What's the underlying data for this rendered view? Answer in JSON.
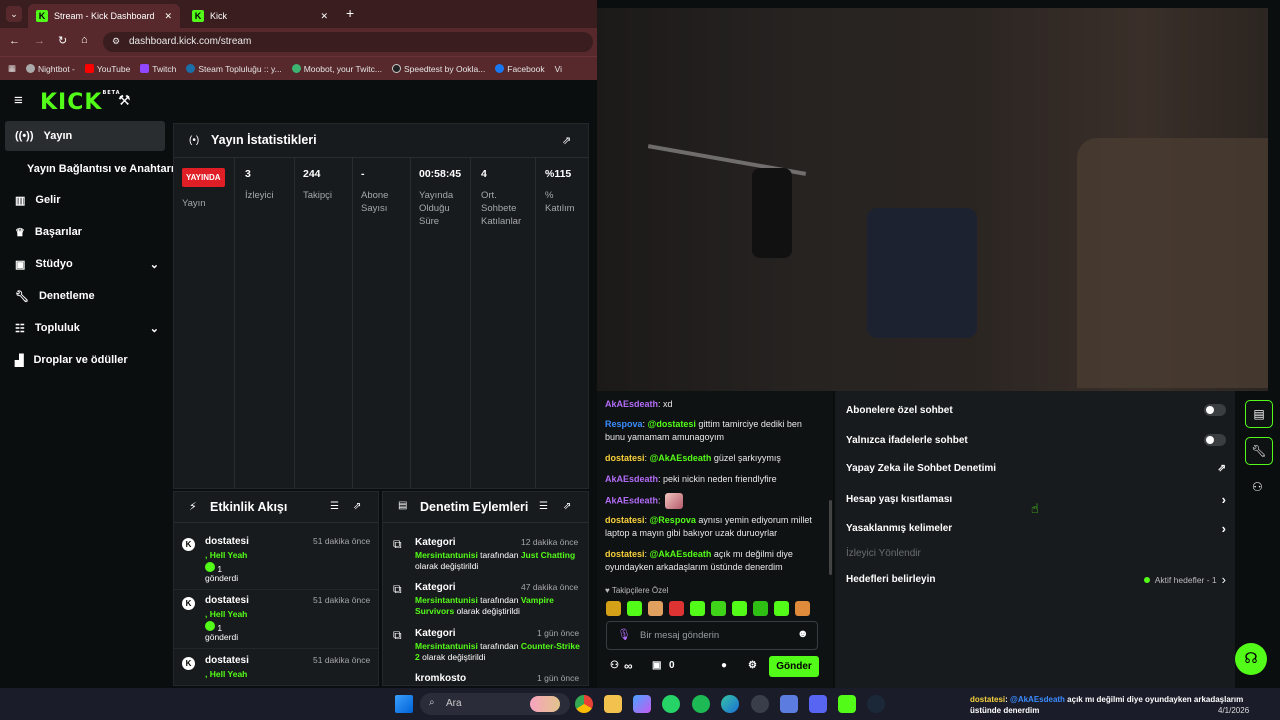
{
  "browser": {
    "tabs": [
      {
        "label": "Stream - Kick Dashboard",
        "active": true
      },
      {
        "label": "Kick",
        "active": false
      }
    ],
    "url": "dashboard.kick.com/stream",
    "bookmarks": [
      "Nightbot -",
      "YouTube",
      "Twitch",
      "Steam Topluluğu :: y...",
      "Moobot, your Twitc...",
      "Speedtest by Ookla...",
      "Facebook",
      "Vi"
    ]
  },
  "brand": {
    "logo": "KICK",
    "beta": "BETA",
    "accent": "#53fc18"
  },
  "sidebar": {
    "items": [
      {
        "label": "Yayın",
        "icon": "broadcast-icon"
      },
      {
        "label": "Yayın Bağlantısı ve Anahtarı",
        "icon": ""
      },
      {
        "label": "Gelir",
        "icon": "chart-icon"
      },
      {
        "label": "Başarılar",
        "icon": "trophy-icon"
      },
      {
        "label": "Stüdyo",
        "icon": "studio-icon"
      },
      {
        "label": "Denetleme",
        "icon": "wrench-icon"
      },
      {
        "label": "Topluluk",
        "icon": "community-icon"
      },
      {
        "label": "Droplar ve ödüller",
        "icon": "drops-icon"
      }
    ]
  },
  "stats": {
    "title": "Yayın İstatistikleri",
    "live_badge": "YAYINDA",
    "live_label": "Yayın",
    "cols": [
      {
        "value": "3",
        "label": "İzleyici"
      },
      {
        "value": "244",
        "label": "Takipçi"
      },
      {
        "value": "-",
        "label": "Abone Sayısı"
      },
      {
        "value": "00:58:45",
        "label": "Yayında Olduğu Süre"
      },
      {
        "value": "4",
        "label": "Ort. Sohbete Katılanlar"
      },
      {
        "value": "%115",
        "label": "% Katılım"
      }
    ]
  },
  "activity": {
    "title": "Etkinlik Akışı",
    "items": [
      {
        "user": "dostatesi",
        "time": "51 dakika önce",
        "text1": ", Hell Yeah",
        "count": "1",
        "text2": "gönderdi"
      },
      {
        "user": "dostatesi",
        "time": "51 dakika önce",
        "text1": ", Hell Yeah",
        "count": "1",
        "text2": "gönderdi"
      },
      {
        "user": "dostatesi",
        "time": "51 dakika önce",
        "text1": ", Hell Yeah",
        "count": "",
        "text2": ""
      }
    ]
  },
  "moderation": {
    "title": "Denetim Eylemleri",
    "items": [
      {
        "title": "Kategori",
        "time": "12 dakika önce",
        "user": "Mersintantunisi",
        "mid": " tarafından ",
        "target": "Just Chatting",
        "tail": " olarak değiştirildi"
      },
      {
        "title": "Kategori",
        "time": "47 dakika önce",
        "user": "Mersintantunisi",
        "mid": " tarafından ",
        "target": "Vampire Survivors",
        "tail": " olarak değiştirildi"
      },
      {
        "title": "Kategori",
        "time": "1 gün önce",
        "user": "Mersintantunisi",
        "mid": " tarafından ",
        "target": "Counter-Strike 2",
        "tail": " olarak değiştirildi"
      },
      {
        "title": "kromkosto",
        "time": "1 gün önce",
        "user": "",
        "mid": "",
        "target": "",
        "tail": ""
      }
    ]
  },
  "chat": {
    "messages": [
      {
        "user": "AkAEsdeath",
        "color": "u1",
        "text": ": xd"
      },
      {
        "user": "Respova",
        "color": "u2",
        "text": ": ",
        "mention": "@dostatesi",
        "rest": " gittim tamirciye dediki ben bunu yamamam amunagoyım"
      },
      {
        "user": "dostatesi",
        "color": "u3",
        "text": ": ",
        "mention": "@AkAEsdeath",
        "rest": " güzel şarkıyymış"
      },
      {
        "user": "AkAEsdeath",
        "color": "u1",
        "text": ": peki nickin neden friendlyfire"
      },
      {
        "user": "AkAEsdeath",
        "color": "u1",
        "text": ":"
      },
      {
        "user": "dostatesi",
        "color": "u3",
        "text": ": ",
        "mention": "@Respova",
        "rest": " aynısı yemin ediyorum millet laptop a mayın gibi bakıyor uzak duruoyrlar"
      },
      {
        "user": "dostatesi",
        "color": "u3",
        "text": ": ",
        "mention": "@AkAEsdeath",
        "rest": " açık mı değilmi diye oyundayken arkadaşlarım üstünde denerdim"
      }
    ],
    "followers_label": "Takipçilere Özel",
    "input_placeholder": "Bir mesaj gönderin",
    "infinity": "∞",
    "count": "0",
    "send_label": "Gönder"
  },
  "settings": {
    "rows": [
      {
        "label": "Abonelere özel sohbet",
        "type": "toggle"
      },
      {
        "label": "Yalnızca ifadelerle sohbet",
        "type": "toggle"
      },
      {
        "label": "Yapay Zeka ile Sohbet Denetimi",
        "type": "external"
      },
      {
        "label": "Hesap yaşı kısıtlaması",
        "type": "chevron"
      },
      {
        "label": "Yasaklanmış kelimeler",
        "type": "chevron"
      }
    ],
    "section": "İzleyici Yönlendir",
    "goals": {
      "label": "Hedefleri belirleyin",
      "status": "Aktif hedefler - 1"
    }
  },
  "taskbar": {
    "search": "Ara",
    "date": "4/1/2026",
    "notif_user": "dostatesi",
    "notif_mention": "@AkAEsdeath",
    "notif_text": " açık mı değilmi diye oyundayken arkadaşlarım üstünde denerdim"
  }
}
